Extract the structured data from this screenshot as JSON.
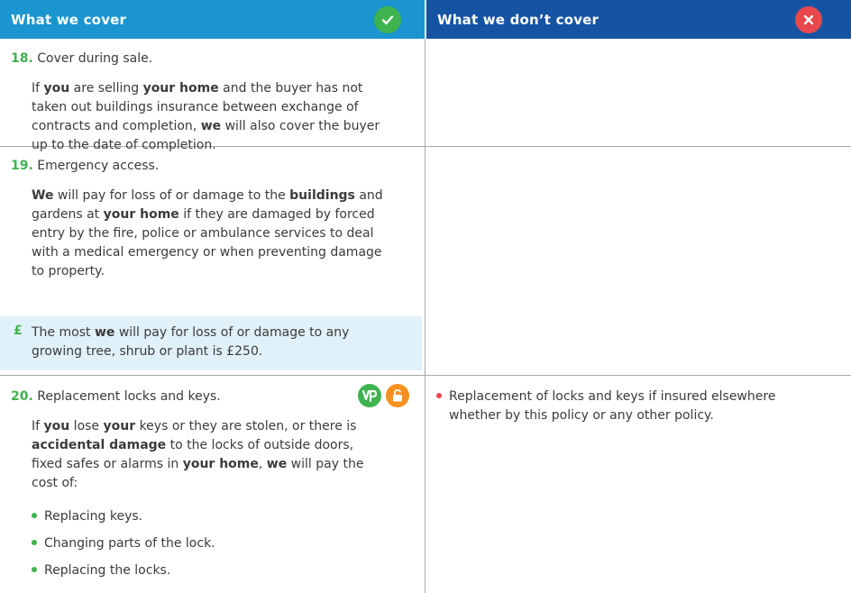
{
  "header": {
    "cover_title": "What we cover",
    "not_cover_title": "What we don’t cover"
  },
  "colors": {
    "cover_header": "#1b95cf",
    "not_cover_header": "#1554a3",
    "accent_green": "#3fb34f",
    "accent_red": "#e8474c",
    "limit_background": "#e1f1f9"
  },
  "icons": {
    "cover_badge": "check-icon",
    "not_cover_badge": "cross-icon",
    "row20_icon1": "vp-icon",
    "row20_icon2": "padlock-icon"
  },
  "rows": [
    {
      "number": "18.",
      "title": "Cover during sale.",
      "body": {
        "t1": "If ",
        "b1": "you",
        "t2": " are selling ",
        "b2": "your home",
        "t3": " and the buyer has not",
        "line2": "taken out buildings insurance between exchange of",
        "t4": "contracts and completion, ",
        "b3": "we",
        "t5": " will also cover the buyer",
        "line4": "up to the date of completion."
      }
    },
    {
      "number": "19.",
      "title": "Emergency access.",
      "body": {
        "b1": "We",
        "t1": " will pay for loss of or damage to the ",
        "b2": "buildings",
        "t2": " and",
        "t3": "gardens at ",
        "b3": "your home",
        "t4": " if they are damaged by forced",
        "line3": "entry by the fire, police or ambulance services to deal",
        "line4": "with a medical emergency or when preventing damage",
        "line5": "to property."
      },
      "limit": {
        "symbol": "£",
        "t1": "The most ",
        "b1": "we",
        "t2": " will pay for loss of or damage to any",
        "line2": "growing tree, shrub or plant is £250."
      }
    },
    {
      "number": "20.",
      "title": "Replacement locks and keys.",
      "body": {
        "t1": "If ",
        "b1": "you",
        "t2": " lose ",
        "b2": "your",
        "t3": " keys or they are stolen, or there is",
        "b3": "accidental damage",
        "t4": " to the locks of outside doors,",
        "line3": "fixed safes or alarms in ",
        "b4": "your home",
        "t5": ", ",
        "b5": "we",
        "t6": " will pay the",
        "line4": "cost of:"
      },
      "bullets": [
        "Replacing keys.",
        "Changing parts of the lock.",
        "Replacing the locks."
      ],
      "not_covered": {
        "line1": "Replacement of locks and keys if insured elsewhere",
        "line2": "whether by this policy or any other policy."
      }
    }
  ]
}
